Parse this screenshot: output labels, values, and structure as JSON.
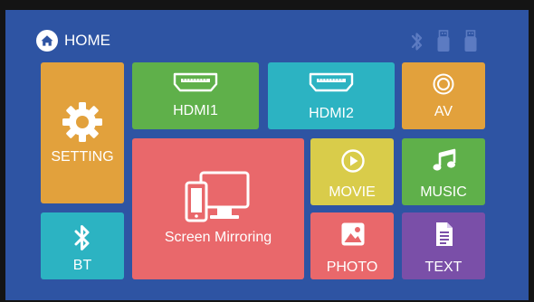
{
  "header": {
    "home_label": "HOME",
    "home_icon": "home-icon",
    "status_icons": [
      "bluetooth-icon",
      "usb-drive-icon",
      "usb-drive-icon"
    ]
  },
  "tiles": {
    "setting": {
      "label": "SETTING",
      "icon": "gear-icon",
      "color": "#e2a13c"
    },
    "hdmi1": {
      "label": "HDMI1",
      "icon": "hdmi-port-icon",
      "color": "#5fb04a"
    },
    "hdmi2": {
      "label": "HDMI2",
      "icon": "hdmi-port-icon",
      "color": "#2cb3c2"
    },
    "av": {
      "label": "AV",
      "icon": "av-input-icon",
      "color": "#e2a13c"
    },
    "screen_mirroring": {
      "label": "Screen Mirroring",
      "icon": "phone-monitor-icon",
      "color": "#e9686b"
    },
    "movie": {
      "label": "MOVIE",
      "icon": "play-icon",
      "color": "#d9cc4a"
    },
    "music": {
      "label": "MUSIC",
      "icon": "music-note-icon",
      "color": "#5fb04a"
    },
    "bt": {
      "label": "BT",
      "icon": "bluetooth-icon",
      "color": "#2cb3c2"
    },
    "photo": {
      "label": "PHOTO",
      "icon": "photo-icon",
      "color": "#e9686b"
    },
    "text": {
      "label": "TEXT",
      "icon": "document-icon",
      "color": "#7a4fa8"
    }
  },
  "colors": {
    "background": "#2e54a3",
    "status_icon": "#5f7ec4"
  }
}
